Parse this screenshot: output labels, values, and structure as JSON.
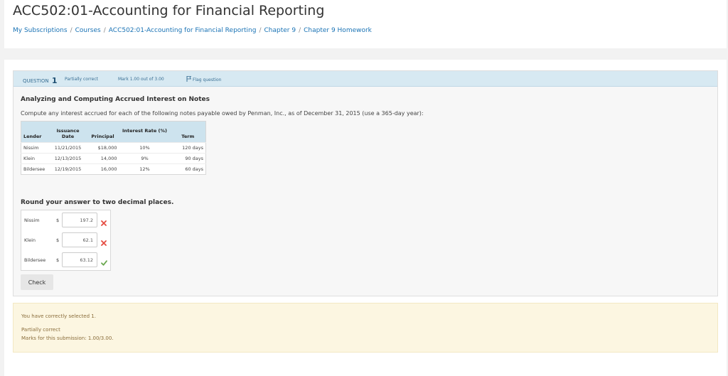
{
  "header": {
    "title": "ACC502:01-Accounting for Financial Reporting",
    "breadcrumb": [
      "My Subscriptions",
      "Courses",
      "ACC502:01-Accounting for Financial Reporting",
      "Chapter 9",
      "Chapter 9 Homework"
    ],
    "separator": "/"
  },
  "question": {
    "label": "QUESTION",
    "number": "1",
    "state": "Partially correct",
    "grade": "Mark 1.00 out of 3.00",
    "flag_label": "Flag question",
    "flag_icon": "flag-icon",
    "heading": "Analyzing and Computing Accrued Interest on Notes",
    "text": "Compute any interest accrued for each of the following notes payable owed by Penman, Inc., as of December 31, 2015 (use a 365-day year):",
    "table": {
      "headers": [
        "Lender",
        "Issuance Date",
        "Principal",
        "Interest Rate (%)",
        "Term"
      ],
      "rows": [
        [
          "Nissim",
          "11/21/2015",
          "$18,000",
          "10%",
          "120 days"
        ],
        [
          "Klein",
          "12/13/2015",
          "14,000",
          "9%",
          "90 days"
        ],
        [
          "Bildersee",
          "12/19/2015",
          "16,000",
          "12%",
          "60 days"
        ]
      ]
    },
    "round_note": "Round your answer to two decimal places.",
    "answers": [
      {
        "lender": "Nissim",
        "currency": "$",
        "value": "197.2",
        "status": "incorrect",
        "icon": "cross-icon"
      },
      {
        "lender": "Klein",
        "currency": "$",
        "value": "62.1",
        "status": "incorrect",
        "icon": "cross-icon"
      },
      {
        "lender": "Bildersee",
        "currency": "$",
        "value": "63.12",
        "status": "correct",
        "icon": "check-icon"
      }
    ],
    "check_label": "Check"
  },
  "feedback": {
    "line1": "You have correctly selected 1.",
    "line2": "Partially correct",
    "line3": "Marks for this submission: 1.00/3.00."
  },
  "colors": {
    "link": "#1a73b5",
    "info_bar": "#d7e9f2",
    "incorrect": "#e54d42",
    "correct": "#6aa84f",
    "feedback_bg": "#fcf6e1",
    "feedback_text": "#8a6d3b"
  }
}
